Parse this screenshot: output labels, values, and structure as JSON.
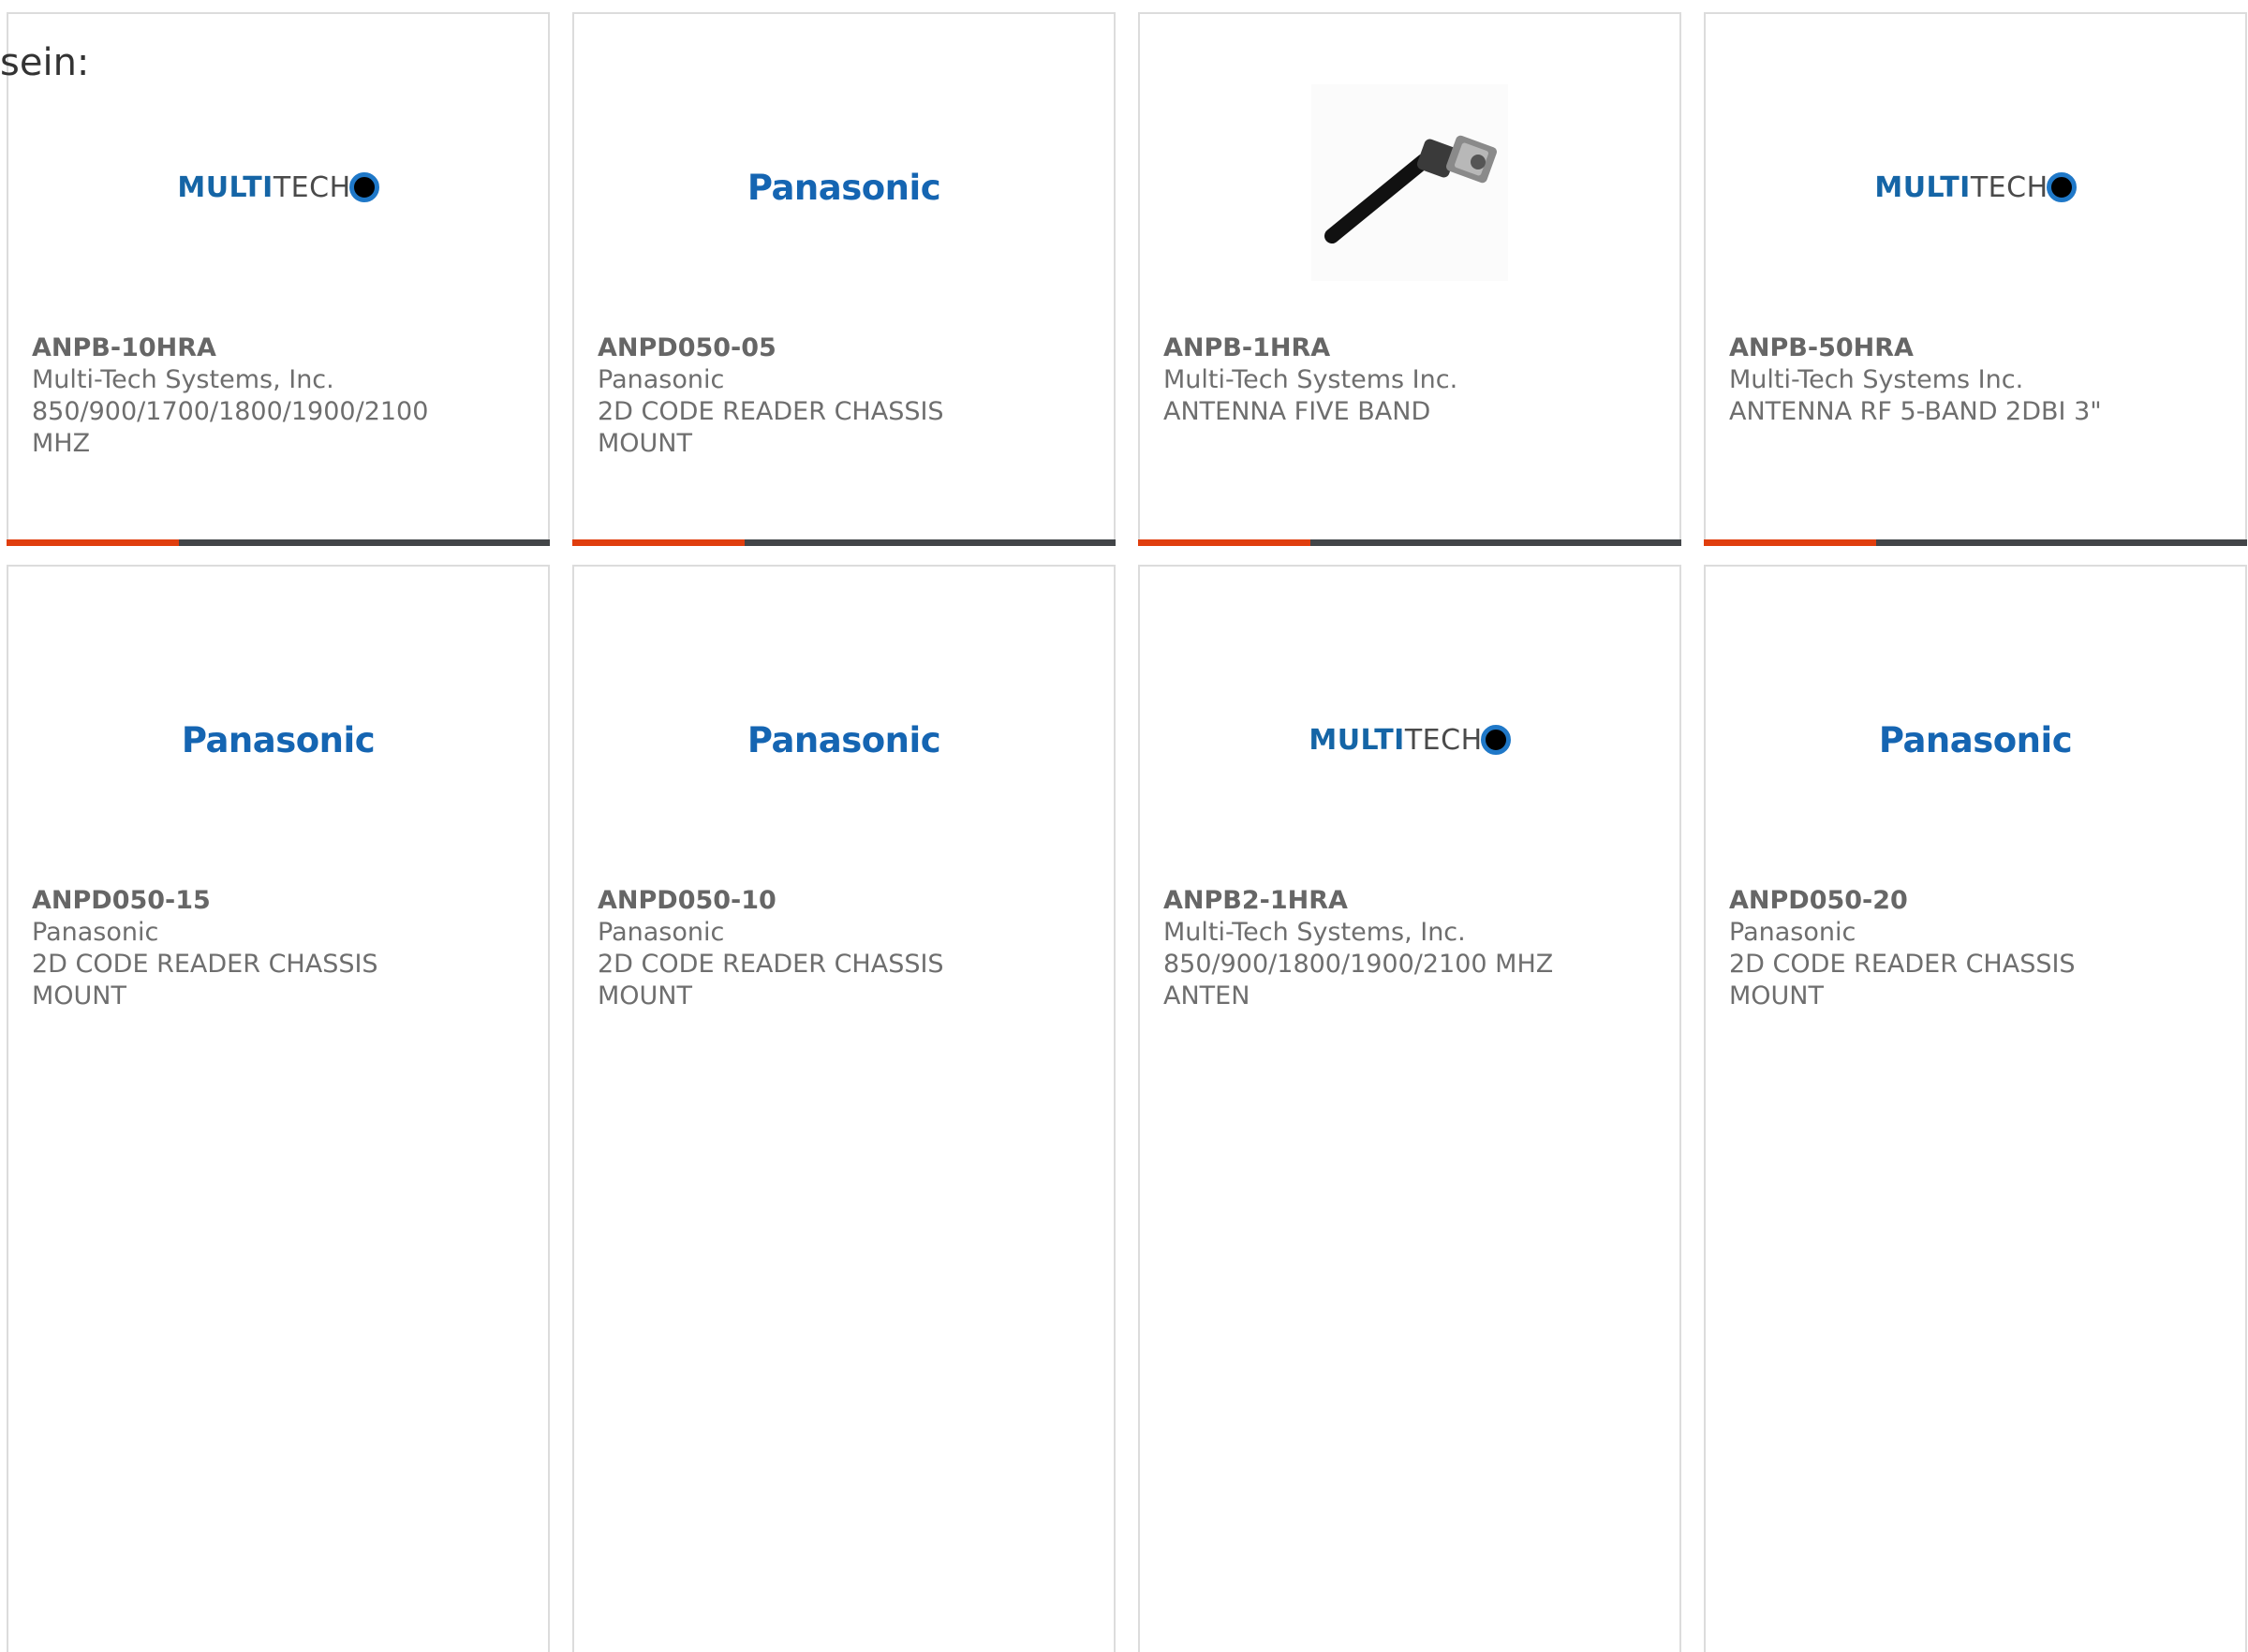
{
  "intro_text": "sein:",
  "products": [
    {
      "part_number": "ANPB-10HRA",
      "manufacturer": "Multi-Tech Systems, Inc.",
      "description": "850/900/1700/1800/1900/2100 MHZ",
      "logo": "multitech-logo"
    },
    {
      "part_number": "ANPD050-05",
      "manufacturer": "Panasonic",
      "description": "2D CODE READER CHASSIS MOUNT",
      "logo": "panasonic-logo"
    },
    {
      "part_number": "ANPB-1HRA",
      "manufacturer": "Multi-Tech Systems Inc.",
      "description": "ANTENNA FIVE BAND",
      "logo": "antenna-photo"
    },
    {
      "part_number": "ANPB-50HRA",
      "manufacturer": "Multi-Tech Systems Inc.",
      "description": "ANTENNA RF 5-BAND 2DBI 3\"",
      "logo": "multitech-logo"
    },
    {
      "part_number": "ANPD050-15",
      "manufacturer": "Panasonic",
      "description": "2D CODE READER CHASSIS MOUNT",
      "logo": "panasonic-logo"
    },
    {
      "part_number": "ANPD050-10",
      "manufacturer": "Panasonic",
      "description": "2D CODE READER CHASSIS MOUNT",
      "logo": "panasonic-logo"
    },
    {
      "part_number": "ANPB2-1HRA",
      "manufacturer": "Multi-Tech Systems, Inc.",
      "description": "850/900/1800/1900/2100 MHZ ANTEN",
      "logo": "multitech-logo"
    },
    {
      "part_number": "ANPD050-20",
      "manufacturer": "Panasonic",
      "description": "2D CODE READER CHASSIS MOUNT",
      "logo": "panasonic-logo"
    }
  ],
  "logos": {
    "multitech_bold": "MULTI",
    "multitech_light": "TECH",
    "panasonic": "Panasonic"
  },
  "colors": {
    "accent_orange": "#e03e0e",
    "accent_dark": "#424548",
    "brand_blue": "#1565b2"
  }
}
